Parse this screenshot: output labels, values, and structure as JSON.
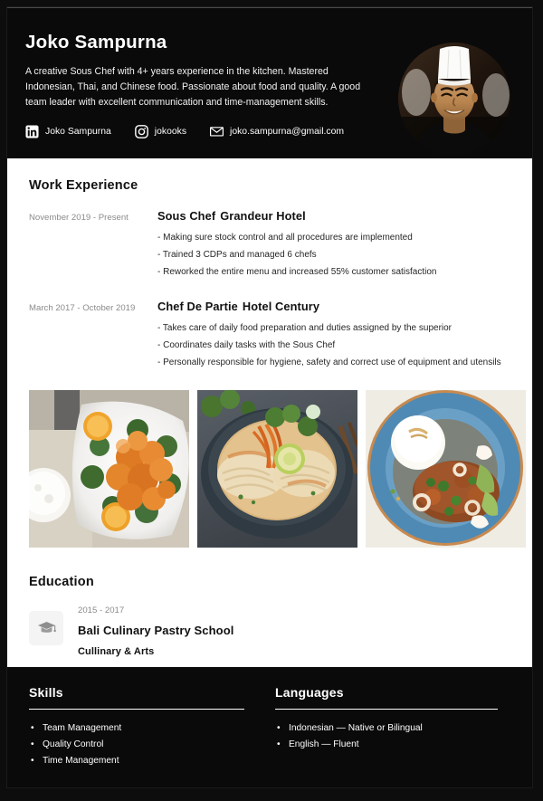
{
  "header": {
    "full_name": "Joko Sampurna",
    "summary": "A creative Sous Chef with 4+ years experience in the kitchen. Mastered Indonesian, Thai, and Chinese food. Passionate about food and quality. A good team leader with excellent communication and time-management skills.",
    "contacts": [
      {
        "icon": "linkedin-icon",
        "label": "Joko Sampurna"
      },
      {
        "icon": "instagram-icon",
        "label": "jokooks"
      },
      {
        "icon": "email-icon",
        "label": "joko.sampurna@gmail.com"
      }
    ],
    "avatar_alt": "portrait of chef wearing white toque"
  },
  "work_experience": {
    "title": "Work Experience",
    "entries": [
      {
        "dates": "November 2019 - Present",
        "role": "Sous Chef",
        "company": "Grandeur Hotel",
        "bullets": [
          "- Making sure stock control and all procedures are implemented",
          "- Trained 3 CDPs and managed 6 chefs",
          "- Reworked the entire menu and increased 55% customer satisfaction"
        ]
      },
      {
        "dates": "March 2017 - October 2019",
        "role": "Chef De Partie",
        "company": "Hotel Century",
        "bullets": [
          "- Takes care of daily food preparation and duties assigned by the superior",
          "- Coordinates daily tasks with the Sous Chef",
          "- Personally responsible for hygiene, safety and correct use of equipment and utensils"
        ]
      }
    ]
  },
  "photos": [
    {
      "alt": "orange chicken with broccoli and orange slices on white plate with rice bowl"
    },
    {
      "alt": "creamy laksa noodle soup in dark bowl with lime and herbs"
    },
    {
      "alt": "rice with spicy squid sambal and avocado on blue plate"
    }
  ],
  "education": {
    "title": "Education",
    "icon": "graduation-cap-icon",
    "entries": [
      {
        "years": "2015 - 2017",
        "school": "Bali Culinary Pastry School",
        "major": "Cullinary & Arts"
      }
    ]
  },
  "footer": {
    "skills": {
      "title": "Skills",
      "items": [
        "Team Management",
        "Quality Control",
        "Time Management"
      ]
    },
    "languages": {
      "title": "Languages",
      "items": [
        "Indonesian — Native or Bilingual",
        "English — Fluent"
      ]
    }
  },
  "colors": {
    "dark_bg": "#0a0a0a",
    "page_bg": "#0d0d0d",
    "card_bg": "#ffffff",
    "muted_text": "#8b8b8b",
    "body_text": "#262626"
  }
}
